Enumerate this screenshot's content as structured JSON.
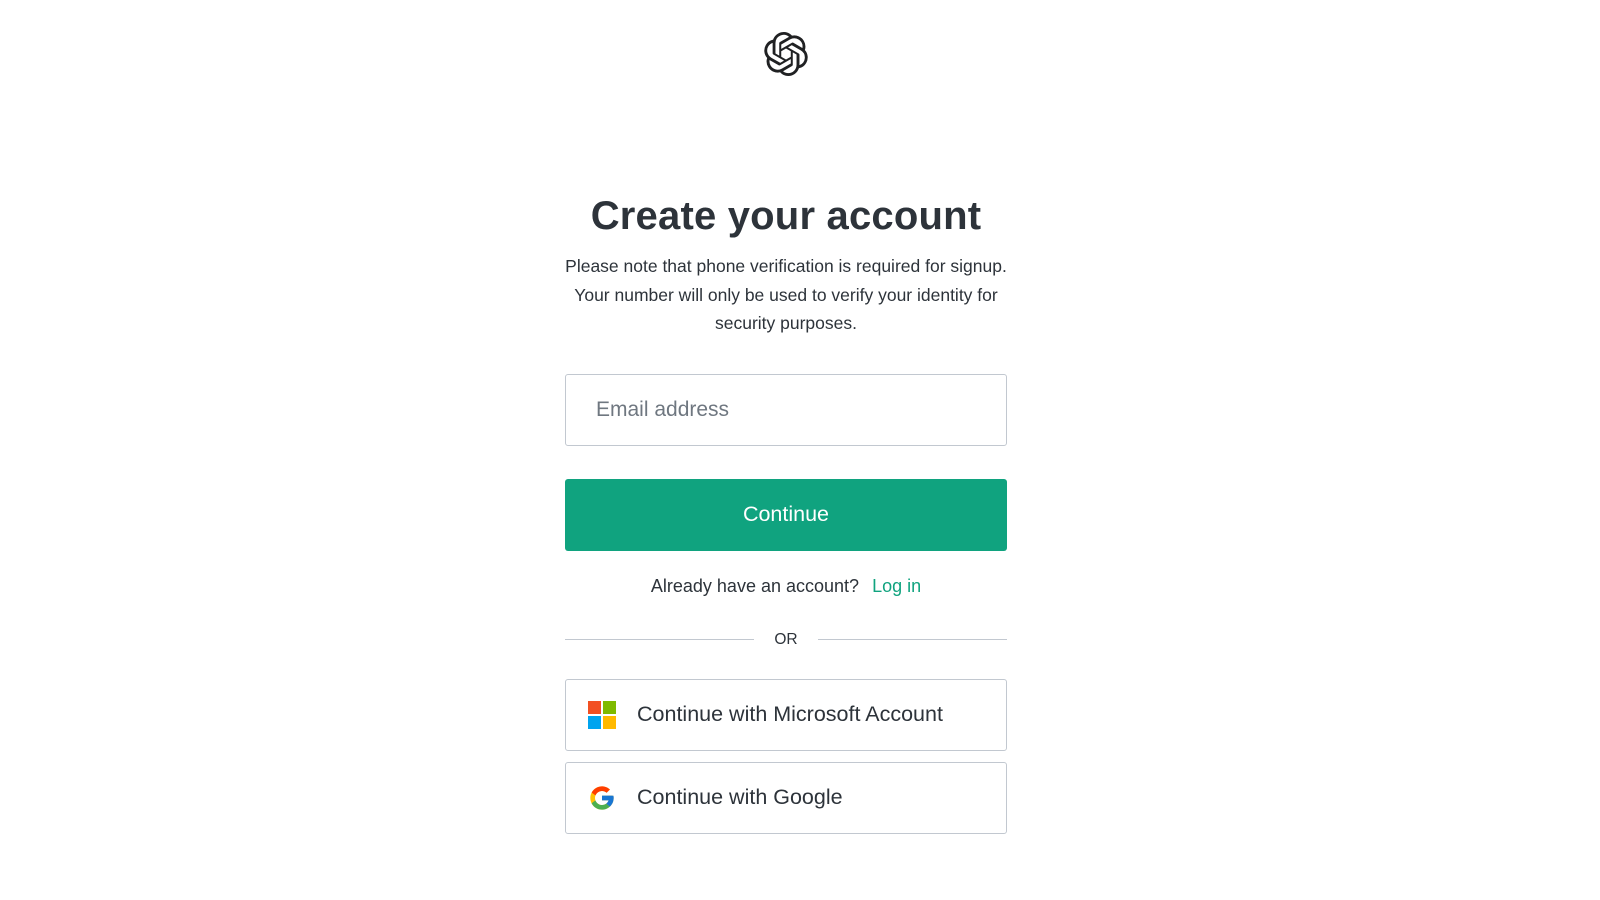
{
  "header": {
    "logo_icon": "openai-logo-icon"
  },
  "main": {
    "title": "Create your account",
    "subtitle": "Please note that phone verification is required for signup. Your number will only be used to verify your identity for security purposes.",
    "email": {
      "placeholder": "Email address",
      "value": ""
    },
    "continue_label": "Continue",
    "login_prompt": "Already have an account?",
    "login_link": "Log in",
    "divider_text": "OR",
    "social": [
      {
        "label": "Continue with Microsoft Account",
        "icon": "microsoft-icon"
      },
      {
        "label": "Continue with Google",
        "icon": "google-icon"
      }
    ]
  },
  "colors": {
    "accent": "#10a37f",
    "text": "#2d333a",
    "border": "#c2c8d0",
    "background": "#ffffff"
  }
}
